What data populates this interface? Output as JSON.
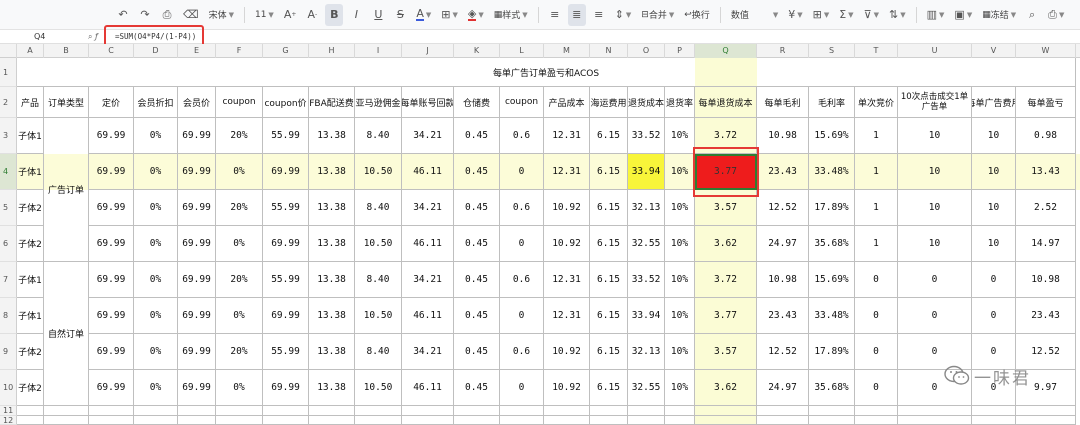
{
  "toolbar": {
    "font_name": "宋体",
    "font_size": "11",
    "style_label": "样式",
    "merge_label": "合并",
    "wrap_label": "换行",
    "number_format": "数值",
    "freeze_label": "冻结"
  },
  "formula_bar": {
    "cell_ref": "Q4",
    "formula": "=SUM(O4*P4/(1-P4))"
  },
  "columns": [
    "A",
    "B",
    "C",
    "D",
    "E",
    "F",
    "G",
    "H",
    "I",
    "J",
    "K",
    "L",
    "M",
    "N",
    "O",
    "P",
    "Q",
    "R",
    "S",
    "T",
    "U",
    "V",
    "W"
  ],
  "rows": [
    "1",
    "2",
    "3",
    "4",
    "5",
    "6",
    "7",
    "8",
    "9",
    "10",
    "11",
    "12"
  ],
  "sheet": {
    "title": "每单广告订单盈亏和ACOS",
    "headers": [
      "产品",
      "订单类型",
      "定价",
      "会员折扣",
      "会员价",
      "coupon",
      "coupon价",
      "FBA配送费",
      "亚马逊佣金",
      "每单账号回款",
      "仓储费",
      "coupon",
      "产品成本",
      "海运费用",
      "退货成本",
      "退货率",
      "每单退货成本",
      "每单毛利",
      "毛利率",
      "单次竞价",
      "10次点击成交1单广告单",
      "每单广告费用",
      "每单盈亏"
    ],
    "groups": [
      "广告订单",
      "自然订单"
    ],
    "data_rows": [
      [
        "子体1",
        "69.99",
        "0%",
        "69.99",
        "20%",
        "55.99",
        "13.38",
        "8.40",
        "34.21",
        "0.45",
        "0.6",
        "12.31",
        "6.15",
        "33.52",
        "10%",
        "3.72",
        "10.98",
        "15.69%",
        "1",
        "10",
        "10",
        "0.98"
      ],
      [
        "子体1",
        "69.99",
        "0%",
        "69.99",
        "0%",
        "69.99",
        "13.38",
        "10.50",
        "46.11",
        "0.45",
        "0",
        "12.31",
        "6.15",
        "33.94",
        "10%",
        "3.77",
        "23.43",
        "33.48%",
        "1",
        "10",
        "10",
        "13.43"
      ],
      [
        "子体2",
        "69.99",
        "0%",
        "69.99",
        "20%",
        "55.99",
        "13.38",
        "8.40",
        "34.21",
        "0.45",
        "0.6",
        "10.92",
        "6.15",
        "32.13",
        "10%",
        "3.57",
        "12.52",
        "17.89%",
        "1",
        "10",
        "10",
        "2.52"
      ],
      [
        "子体2",
        "69.99",
        "0%",
        "69.99",
        "0%",
        "69.99",
        "13.38",
        "10.50",
        "46.11",
        "0.45",
        "0",
        "10.92",
        "6.15",
        "32.55",
        "10%",
        "3.62",
        "24.97",
        "35.68%",
        "1",
        "10",
        "10",
        "14.97"
      ],
      [
        "子体1",
        "69.99",
        "0%",
        "69.99",
        "20%",
        "55.99",
        "13.38",
        "8.40",
        "34.21",
        "0.45",
        "0.6",
        "12.31",
        "6.15",
        "33.52",
        "10%",
        "3.72",
        "10.98",
        "15.69%",
        "0",
        "0",
        "0",
        "10.98"
      ],
      [
        "子体1",
        "69.99",
        "0%",
        "69.99",
        "0%",
        "69.99",
        "13.38",
        "10.50",
        "46.11",
        "0.45",
        "0",
        "12.31",
        "6.15",
        "33.94",
        "10%",
        "3.77",
        "23.43",
        "33.48%",
        "0",
        "0",
        "0",
        "23.43"
      ],
      [
        "子体2",
        "69.99",
        "0%",
        "69.99",
        "20%",
        "55.99",
        "13.38",
        "8.40",
        "34.21",
        "0.45",
        "0.6",
        "10.92",
        "6.15",
        "32.13",
        "10%",
        "3.57",
        "12.52",
        "17.89%",
        "0",
        "0",
        "0",
        "12.52"
      ],
      [
        "子体2",
        "69.99",
        "0%",
        "69.99",
        "0%",
        "69.99",
        "13.38",
        "10.50",
        "46.11",
        "0.45",
        "0",
        "10.92",
        "6.15",
        "32.55",
        "10%",
        "3.62",
        "24.97",
        "35.68%",
        "0",
        "0",
        "0",
        "9.97"
      ]
    ]
  },
  "watermark": {
    "text": "一味君",
    "icon": "wechat-icon"
  },
  "colors": {
    "highlight_yellow": "#f8f53a",
    "alert_red": "#ee1c1c",
    "selection_green": "#2e7d32"
  }
}
